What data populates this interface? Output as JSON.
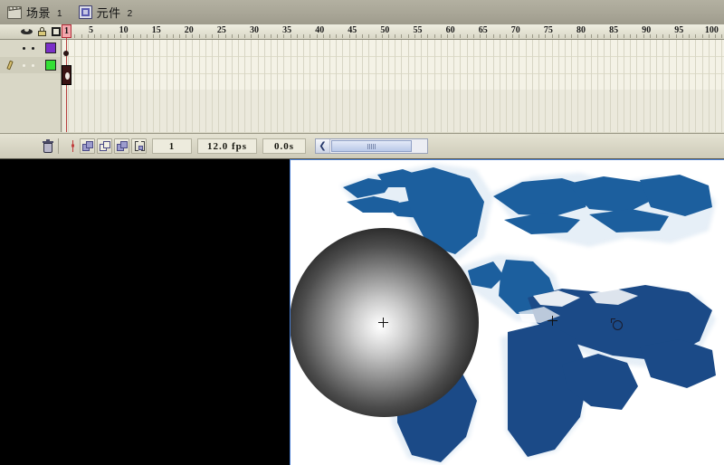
{
  "tabs": [
    {
      "label": "场景",
      "num": "1",
      "icon": "film-slate-icon",
      "active": true
    },
    {
      "label": "元件",
      "num": "2",
      "icon": "movie-symbol-icon",
      "active": false
    }
  ],
  "timeline": {
    "layer_header": {
      "eye_icon": "eye-icon",
      "lock_icon": "lock-icon",
      "outline_icon": "outline-square-icon"
    },
    "layers": [
      {
        "name": "layer-1",
        "color": "#7b30c8",
        "active": false
      },
      {
        "name": "layer-2",
        "color": "#35e035",
        "active": true
      }
    ],
    "ruler": {
      "start": 1,
      "step": 5,
      "labels": [
        "5",
        "10",
        "15",
        "20",
        "25",
        "30",
        "35",
        "40",
        "45",
        "50",
        "55",
        "60",
        "65",
        "70",
        "75",
        "80",
        "85",
        "90",
        "95",
        "100"
      ]
    },
    "playhead": {
      "frame_label": "1",
      "frame": 1
    }
  },
  "statusbar": {
    "trash_icon": "trash-icon",
    "center_frame_icon": "center-frame-marker-icon",
    "onion_skin_icon": "onion-skin-icon",
    "onion_outline_icon": "onion-skin-outline-icon",
    "edit_multiple_icon": "edit-multiple-frames-icon",
    "modify_markers_icon": "modify-onion-markers-icon",
    "current_frame": "1",
    "frame_rate": "12.0  fps",
    "elapsed_time": "0.0s",
    "scroll_left_arrow": "❮"
  },
  "stage": {
    "background": "#ffffff",
    "workspace_background": "#000000",
    "border_color": "#4a7fd4",
    "map_color_light": "#1c5f9e",
    "map_color_dark": "#1b3a74",
    "sphere": {
      "name": "radial-gradient-sphere",
      "center_color": "#ffffff",
      "edge_color": "#000000"
    },
    "registration_points": [
      "sphere-center-crosshair",
      "symbol-registration-crosshair"
    ],
    "cursor": "circle-cursor"
  }
}
